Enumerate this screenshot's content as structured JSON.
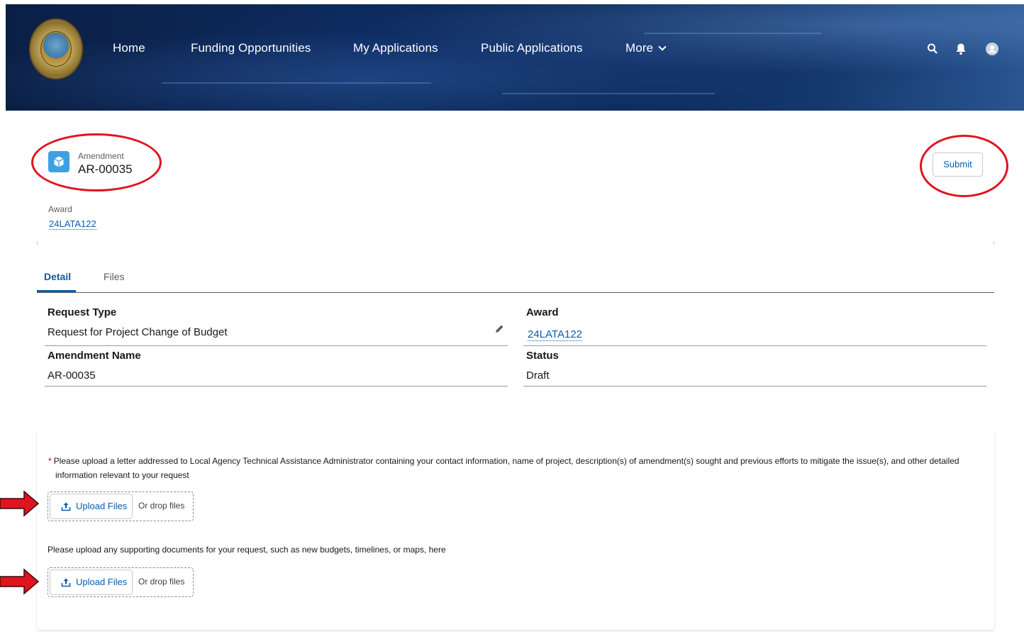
{
  "nav": {
    "items": [
      "Home",
      "Funding Opportunities",
      "My Applications",
      "Public Applications",
      "More"
    ],
    "icons": [
      "search-icon",
      "bell-icon",
      "user-avatar-icon"
    ]
  },
  "record": {
    "type_label": "Amendment",
    "name": "AR-00035",
    "icon": "cube-icon",
    "icon_color": "#3ea0e4",
    "submit_label": "Submit",
    "award_label": "Award",
    "award_value": "24LATA122"
  },
  "tabs": [
    {
      "label": "Detail",
      "active": true
    },
    {
      "label": "Files",
      "active": false
    }
  ],
  "fields": {
    "request_type": {
      "label": "Request Type",
      "value": "Request for Project Change of Budget"
    },
    "award": {
      "label": "Award",
      "value": "24LATA122"
    },
    "amendment_name": {
      "label": "Amendment Name",
      "value": "AR-00035"
    },
    "status": {
      "label": "Status",
      "value": "Draft"
    }
  },
  "uploads": {
    "required_marker": "*",
    "letter_prompt_line1": "Please upload a letter addressed to Local Agency Technical Assistance Administrator containing your contact information, name of project, description(s) of amendment(s) sought and previous efforts to mitigate the issue(s), and other detailed",
    "letter_prompt_line2": "information relevant to your request",
    "supporting_prompt": "Please upload any supporting documents for your request, such as new budgets, timelines, or maps, here",
    "upload_button_label": "Upload Files",
    "drop_label": "Or drop files"
  },
  "colors": {
    "accent": "#0b5cab",
    "annotation_red": "#e0141e",
    "required": "#ba0517"
  }
}
